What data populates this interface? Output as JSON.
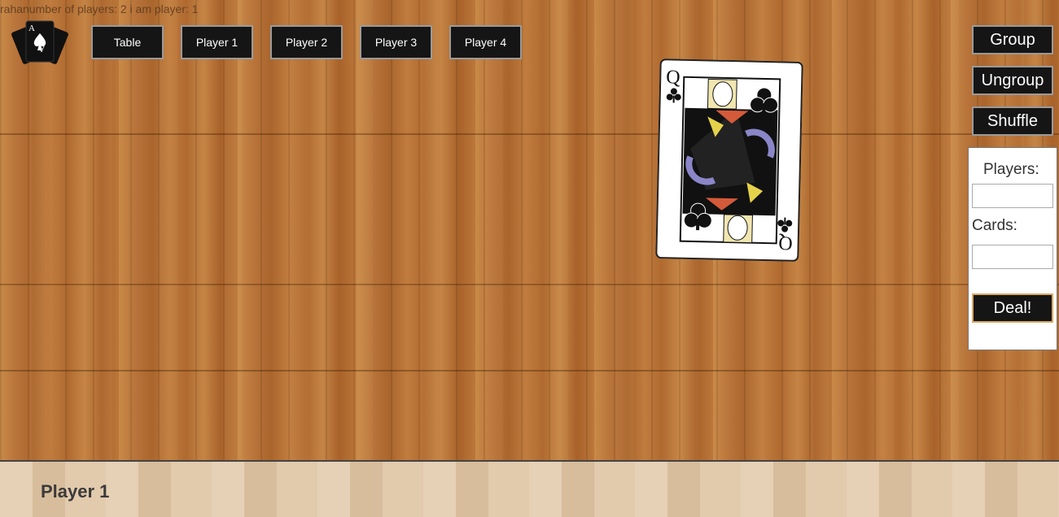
{
  "status_line": "rahanumber of players: 2 i am player: 1",
  "nav": {
    "tabs": [
      "Table",
      "Player 1",
      "Player 2",
      "Player 3",
      "Player 4"
    ]
  },
  "side_buttons": {
    "group": "Group",
    "ungroup": "Ungroup",
    "shuffle": "Shuffle"
  },
  "deal_panel": {
    "players_label": "Players:",
    "players_value": "",
    "cards_label": "Cards:",
    "cards_value": "",
    "deal_button": "Deal!"
  },
  "table_card": {
    "rank": "Q",
    "suit": "clubs"
  },
  "bottom_bar": {
    "label": "Player 1"
  },
  "colors": {
    "button_bg": "#151515",
    "button_text": "#ffffff",
    "wood": "#b5702f"
  }
}
